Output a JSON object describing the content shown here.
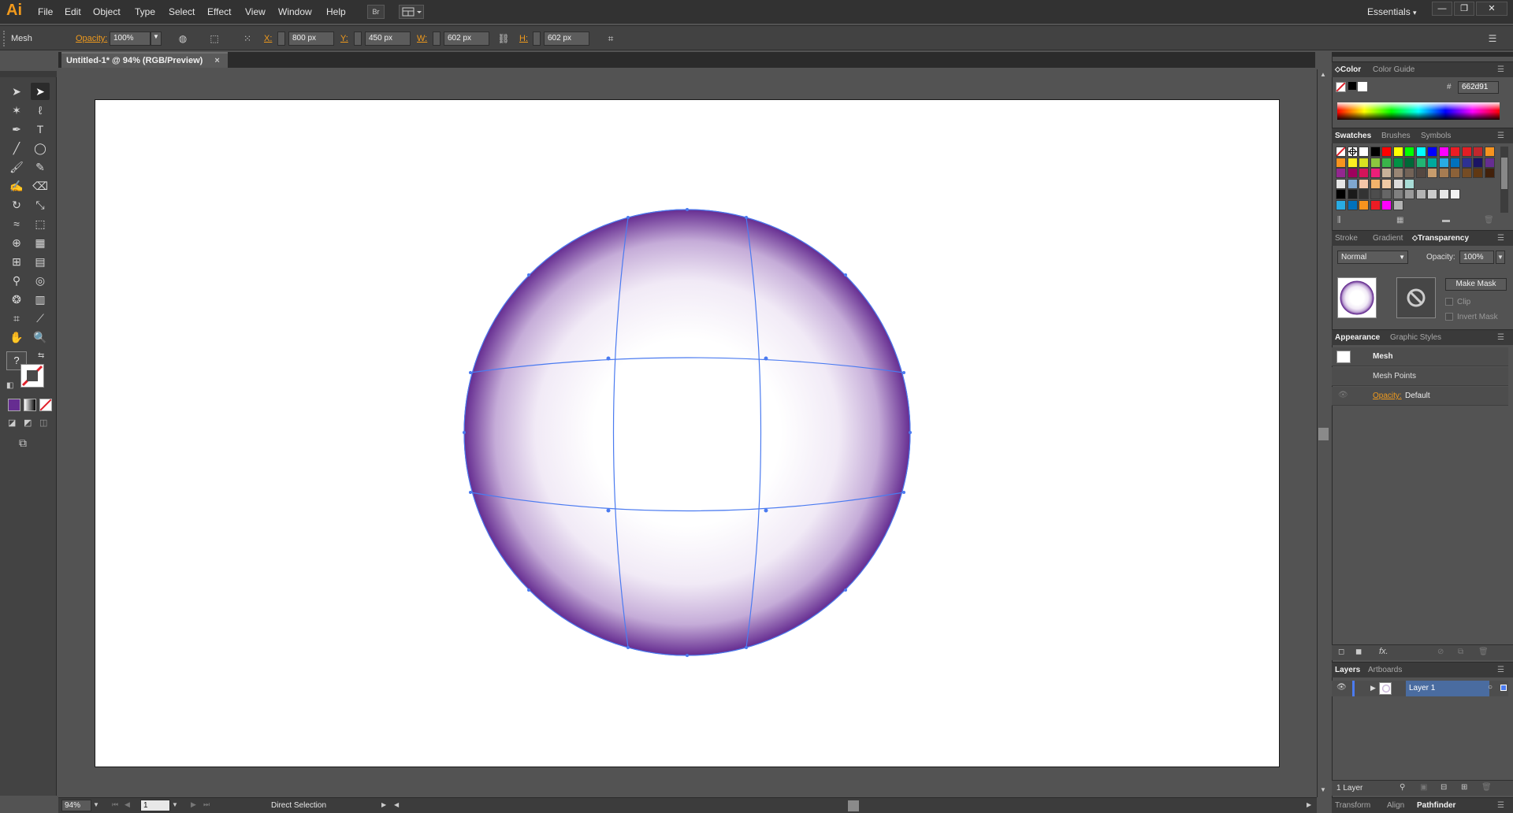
{
  "app": {
    "logo": "Ai"
  },
  "menu": {
    "items": [
      "File",
      "Edit",
      "Object",
      "Type",
      "Select",
      "Effect",
      "View",
      "Window",
      "Help"
    ],
    "bridge_label": "Br",
    "workspace": "Essentials"
  },
  "window_controls": {
    "minimize": "—",
    "restore": "❐",
    "close": "✕"
  },
  "control_bar": {
    "selection_label": "Mesh",
    "opacity_label": "Opacity:",
    "opacity_value": "100%",
    "x_label": "X:",
    "x_value": "800 px",
    "y_label": "Y:",
    "y_value": "450 px",
    "w_label": "W:",
    "w_value": "602 px",
    "h_label": "H:",
    "h_value": "602 px"
  },
  "document": {
    "tab_title": "Untitled-1* @ 94% (RGB/Preview)",
    "close": "×"
  },
  "tools": {
    "unknown_label": "?"
  },
  "mesh_colors": {
    "edge": "#662d91",
    "center": "#ffffff"
  },
  "status": {
    "zoom": "94%",
    "page": "1",
    "current_tool": "Direct Selection"
  },
  "color_panel": {
    "tabs": [
      "Color",
      "Color Guide"
    ],
    "hash": "#",
    "hex_value": "662d91"
  },
  "swatches_panel": {
    "tabs": [
      "Swatches",
      "Brushes",
      "Symbols"
    ],
    "rows": [
      [
        "none",
        "reg",
        "#ffffff",
        "#000000",
        "#ff0000",
        "#ffff00",
        "#00ff00",
        "#00ffff",
        "#0000ff",
        "#ff00ff",
        "#ed1c24",
        "#e31e24",
        "#c1272d",
        "#f7931e"
      ],
      [
        "#f7931e",
        "#fcee21",
        "#d9e021",
        "#8cc63f",
        "#39b54a",
        "#009245",
        "#006837",
        "#22b573",
        "#00a99d",
        "#29abe2",
        "#0071bc",
        "#2e3192",
        "#1b1464",
        "#662d91"
      ],
      [
        "#93278f",
        "#9e005d",
        "#d4145a",
        "#ed1e79",
        "#c7b299",
        "#998675",
        "#736357",
        "#534741",
        "#c69c6d",
        "#a67c52",
        "#8c6239",
        "#754c24",
        "#603813",
        "#42210b"
      ],
      [
        "#e6e6e6",
        "#7fa7d0",
        "#f7c6a8",
        "#f2b36b",
        "#efc9a4",
        "#dcdcdc",
        "#a8dcd6"
      ],
      [
        "#000000",
        "#1a1a1a",
        "#333333",
        "#4d4d4d",
        "#666666",
        "#808080",
        "#999999",
        "#b3b3b3",
        "#cccccc",
        "#e6e6e6",
        "#f2f2f2"
      ],
      [
        "#29abe2",
        "#0071bc",
        "#f7931e",
        "#ed1c24",
        "#ff00ff",
        "#b3b3b3"
      ]
    ]
  },
  "transparency_panel": {
    "tabs": [
      "Stroke",
      "Gradient",
      "Transparency"
    ],
    "blend_mode": "Normal",
    "opacity_label": "Opacity:",
    "opacity_value": "100%",
    "make_mask": "Make Mask",
    "clip": "Clip",
    "invert_mask": "Invert Mask"
  },
  "appearance_panel": {
    "tabs": [
      "Appearance",
      "Graphic Styles"
    ],
    "object": "Mesh",
    "mesh_points": "Mesh Points",
    "opacity_label": "Opacity:",
    "opacity_value": "Default",
    "fx": "fx."
  },
  "layers_panel": {
    "tabs": [
      "Layers",
      "Artboards"
    ],
    "layer_name": "Layer 1",
    "count": "1 Layer"
  },
  "bottom_tabs": [
    "Transform",
    "Align",
    "Pathfinder"
  ]
}
